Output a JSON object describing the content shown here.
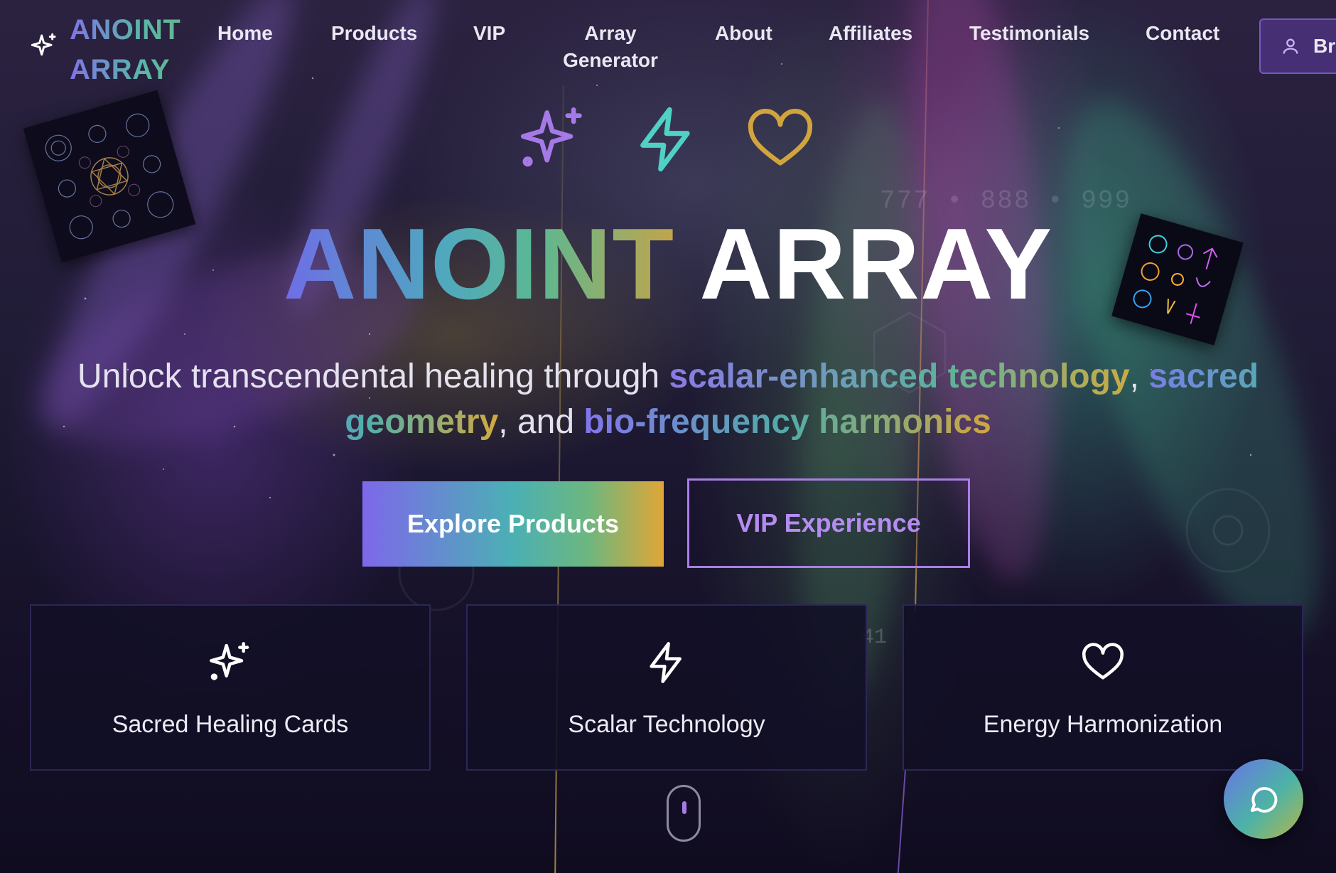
{
  "nav": {
    "logo_line1": "ANOINT",
    "logo_line2": "ARRAY",
    "items": [
      "Home",
      "Products",
      "VIP",
      "Array Generator",
      "About",
      "Affiliates",
      "Testimonials",
      "Contact"
    ],
    "account_label": "Bra"
  },
  "background": {
    "numbers": "777 • 888 • 999",
    "numbers2": "41"
  },
  "hero": {
    "title_part1": "ANOINT",
    "title_part2": "ARRAY",
    "subtitle": {
      "text1": "Unlock transcendental healing through ",
      "highlight1": "scalar-enhanced technology",
      "text2": ", ",
      "highlight2": "sacred geometry",
      "text3": ", and ",
      "highlight3": "bio-frequency harmonics"
    },
    "primary_button": "Explore Products",
    "secondary_button": "VIP Experience"
  },
  "features": [
    {
      "icon": "sparkles-icon",
      "label": "Sacred Healing Cards"
    },
    {
      "icon": "lightning-icon",
      "label": "Scalar Technology"
    },
    {
      "icon": "heart-icon",
      "label": "Energy Harmonization"
    }
  ],
  "colors": {
    "accent_purple": "#9b6ee6",
    "accent_teal": "#4fd1c5",
    "accent_gold": "#d4a93f",
    "background": "#120e24"
  }
}
